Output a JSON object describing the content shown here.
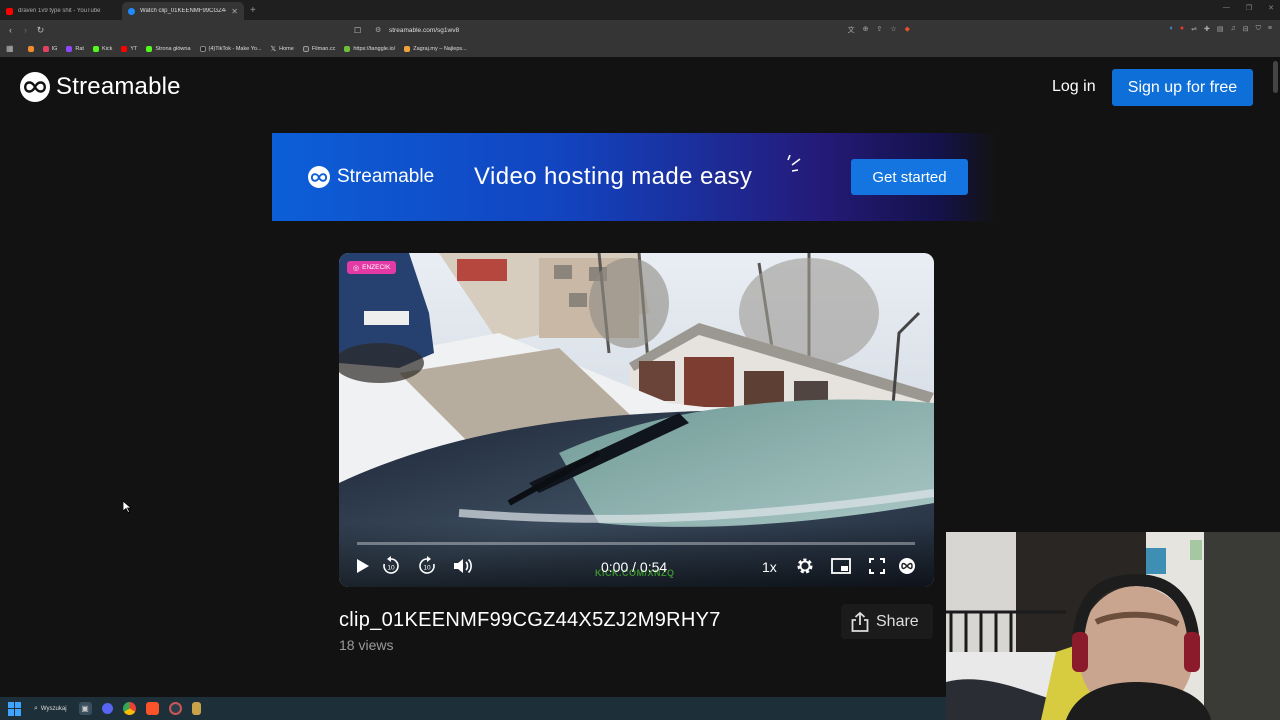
{
  "browser": {
    "tabs": [
      {
        "title": "draven 1v9 type shit - YouTube",
        "favicon_color": "#ff0000",
        "active": false
      },
      {
        "title": "Watch clip_01KEENMF99CGZ44",
        "favicon_color": "#1e8cff",
        "active": true
      }
    ],
    "new_tab": "+",
    "url": "streamable.com/sg1wv8",
    "bookmarks": [
      {
        "label": "",
        "color": "#f28b2c"
      },
      {
        "label": "IG",
        "color": "#e4405f"
      },
      {
        "label": "Rat",
        "color": "#9146ff"
      },
      {
        "label": "Kick",
        "color": "#53fc18"
      },
      {
        "label": "YT",
        "color": "#ff0000"
      },
      {
        "label": "Strona główna",
        "color": "#53fc18"
      },
      {
        "label": "(4)TikTok - Make Yo...",
        "color": "#222222"
      },
      {
        "label": "Home",
        "color": "#000000"
      },
      {
        "label": "Filman.cc",
        "color": "#444444"
      },
      {
        "label": "https://tanggle.io/",
        "color": "#6bbf3a"
      },
      {
        "label": "Zagraj.my – Najleps...",
        "color": "#f2a23a"
      }
    ]
  },
  "header": {
    "logo_text": "Streamable",
    "login_label": "Log in",
    "signup_label": "Sign up for free"
  },
  "banner": {
    "logo_text": "Streamable",
    "tagline": "Video hosting made easy",
    "cta_label": "Get started"
  },
  "player": {
    "channel_badge": "ENZECIK",
    "time": "0:00 / 0:54",
    "speed": "1x",
    "progress": 0,
    "overlay_text": "KICK.COM/XNZQ",
    "icons": [
      "play-icon",
      "rewind-10-icon",
      "forward-10-icon",
      "volume-icon",
      "settings-icon",
      "picture-in-picture-icon",
      "fullscreen-icon",
      "streamable-icon"
    ]
  },
  "clip": {
    "title": "clip_01KEENMF99CGZ44X5ZJ2M9RHY7",
    "views": "18 views",
    "share_label": "Share"
  },
  "taskbar": {
    "search_label": "Wyszukaj"
  },
  "colors": {
    "accent": "#0f6fd9",
    "page_bg": "#121212",
    "badge": "#e43aa6"
  }
}
